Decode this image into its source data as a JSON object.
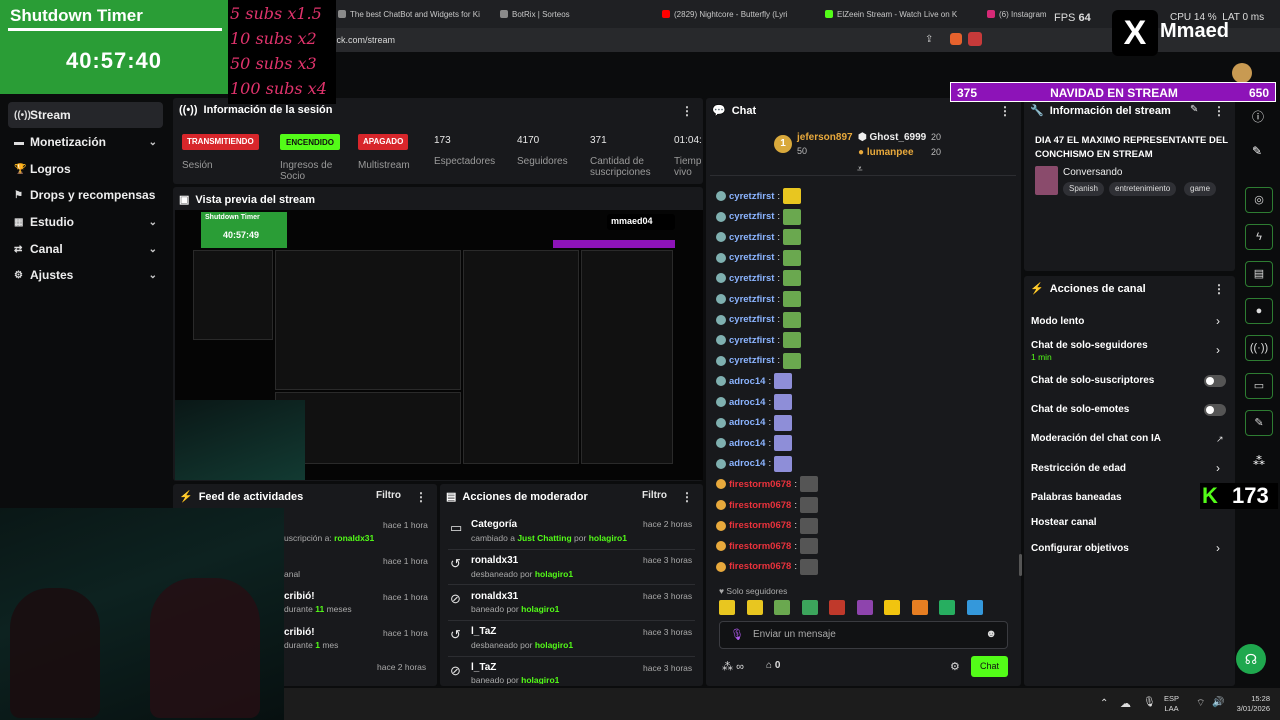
{
  "browser": {
    "tabs": [
      {
        "label": "The best ChatBot and Widgets for Ki",
        "color": "#8a8a8a"
      },
      {
        "label": "BotRix | Sorteos",
        "color": "#8a8a8a"
      },
      {
        "label": "(2829) Nightcore - Butterfly (Lyri",
        "color": "#ff0000"
      },
      {
        "label": "ElZeein Stream - Watch Live on K",
        "color": "#53fc18"
      },
      {
        "label": "(6) Instagram",
        "color": "#d62976"
      }
    ],
    "url": "kick.com/stream"
  },
  "overlay": {
    "timer_title": "Shutdown Timer",
    "timer_value": "40:57:40",
    "goals": [
      "5 subs x1.5",
      "10 subs x2",
      "50 subs x3",
      "100 subs x4"
    ],
    "fps_label": "FPS",
    "fps_value": "64",
    "cpu_label": "CPU",
    "cpu_value": "14 %",
    "lat_label": "LAT",
    "lat_value": "0 ms",
    "x_logo": "X",
    "x_name": "Mmaed",
    "navidad_left": "375",
    "navidad_title": "NAVIDAD EN STREAM",
    "navidad_right": "650",
    "kick_count": "173"
  },
  "sidebar": {
    "items": [
      {
        "label": "Stream",
        "icon": "((•))",
        "chev": false
      },
      {
        "label": "Monetización",
        "icon": "▬",
        "chev": true
      },
      {
        "label": "Logros",
        "icon": "🏆",
        "chev": false
      },
      {
        "label": "Drops y recompensas",
        "icon": "⚑",
        "chev": false
      },
      {
        "label": "Estudio",
        "icon": "▦",
        "chev": true
      },
      {
        "label": "Canal",
        "icon": "⇄",
        "chev": true
      },
      {
        "label": "Ajustes",
        "icon": "⚙",
        "chev": true
      }
    ]
  },
  "session": {
    "title": "Información de la sesión",
    "badges": [
      {
        "label": "TRANSMITIENDO",
        "caption": "Sesión",
        "color": "#d8262b"
      },
      {
        "label": "ENCENDIDO",
        "caption": "Ingresos de Socio",
        "color": "#3cb043"
      },
      {
        "label": "APAGADO",
        "caption": "Multistream",
        "color": "#d8262b"
      }
    ],
    "stats": [
      {
        "value": "173",
        "caption": "Espectadores"
      },
      {
        "value": "4170",
        "caption": "Seguidores"
      },
      {
        "value": "371",
        "caption": "Cantidad de suscripciones"
      },
      {
        "value": "01:04:",
        "caption": "Tiemp vivo"
      }
    ]
  },
  "preview": {
    "title": "Vista previa del stream",
    "timer_title": "Shutdown Timer",
    "timer_value": "40:57:49",
    "handle": "mmaed04"
  },
  "feed": {
    "title": "Feed de actividades",
    "filter": "Filtro",
    "items": [
      {
        "line1": "",
        "line2": "uscripción a:",
        "user": "ronaldx31",
        "time": "hace 1 hora"
      },
      {
        "line1": "",
        "line2": "anal",
        "user": "",
        "time": "hace 1 hora"
      },
      {
        "line1": "cribió!",
        "line2": "durante",
        "user": "11",
        "tail": "meses",
        "time": "hace 1 hora"
      },
      {
        "line1": "cribió!",
        "line2": "durante",
        "user": "1",
        "tail": "mes",
        "time": "hace 1 hora"
      },
      {
        "line1": "",
        "line2": "",
        "user": "",
        "time": "hace 2 horas"
      }
    ]
  },
  "moderator": {
    "title": "Acciones de moderador",
    "filter": "Filtro",
    "items": [
      {
        "title": "Categoría",
        "pre": "cambiado a",
        "target": "Just Chatting",
        "mid": "por",
        "by": "holagiro1",
        "time": "hace 2 horas",
        "icon": "▭"
      },
      {
        "title": "ronaldx31",
        "pre": "desbaneado por",
        "target": "",
        "mid": "",
        "by": "holagiro1",
        "time": "hace 3 horas",
        "icon": "↺"
      },
      {
        "title": "ronaldx31",
        "pre": "baneado por",
        "target": "",
        "mid": "",
        "by": "holagiro1",
        "time": "hace 3 horas",
        "icon": "⊘"
      },
      {
        "title": "l_TaZ",
        "pre": "desbaneado por",
        "target": "",
        "mid": "",
        "by": "holagiro1",
        "time": "hace 3 horas",
        "icon": "↺"
      },
      {
        "title": "l_TaZ",
        "pre": "baneado por",
        "target": "",
        "mid": "",
        "by": "holagiro1",
        "time": "hace 3 horas",
        "icon": "⊘"
      }
    ]
  },
  "chat": {
    "title": "Chat",
    "leaders": [
      {
        "name": "jeferson897",
        "value": "50"
      },
      {
        "name": "Ghost_6999",
        "value": "20"
      },
      {
        "name": "lumanpee",
        "value": "20"
      }
    ],
    "rank": "1",
    "messages": [
      {
        "user": "cyretzfirst",
        "color": "#8bb4ff",
        "emote": "#e8c620"
      },
      {
        "user": "cyretzfirst",
        "color": "#8bb4ff",
        "emote": "#6aa84f"
      },
      {
        "user": "cyretzfirst",
        "color": "#8bb4ff",
        "emote": "#6aa84f"
      },
      {
        "user": "cyretzfirst",
        "color": "#8bb4ff",
        "emote": "#6aa84f"
      },
      {
        "user": "cyretzfirst",
        "color": "#8bb4ff",
        "emote": "#6aa84f"
      },
      {
        "user": "cyretzfirst",
        "color": "#8bb4ff",
        "emote": "#6aa84f"
      },
      {
        "user": "cyretzfirst",
        "color": "#8bb4ff",
        "emote": "#6aa84f"
      },
      {
        "user": "cyretzfirst",
        "color": "#8bb4ff",
        "emote": "#6aa84f"
      },
      {
        "user": "cyretzfirst",
        "color": "#8bb4ff",
        "emote": "#6aa84f"
      },
      {
        "user": "adroc14",
        "color": "#8bb4ff",
        "emote": "#8e8ed8"
      },
      {
        "user": "adroc14",
        "color": "#8bb4ff",
        "emote": "#8e8ed8"
      },
      {
        "user": "adroc14",
        "color": "#8bb4ff",
        "emote": "#8e8ed8"
      },
      {
        "user": "adroc14",
        "color": "#8bb4ff",
        "emote": "#8e8ed8"
      },
      {
        "user": "adroc14",
        "color": "#8bb4ff",
        "emote": "#8e8ed8"
      },
      {
        "user": "firestorm0678",
        "color": "#e8323c",
        "emote": "#555555"
      },
      {
        "user": "firestorm0678",
        "color": "#e8323c",
        "emote": "#555555"
      },
      {
        "user": "firestorm0678",
        "color": "#e8323c",
        "emote": "#555555"
      },
      {
        "user": "firestorm0678",
        "color": "#e8323c",
        "emote": "#555555"
      },
      {
        "user": "firestorm0678",
        "color": "#e8323c",
        "emote": "#555555"
      }
    ],
    "followers_only": "Solo seguidores",
    "input_placeholder": "Enviar un mensaje",
    "infinite": "∞",
    "gift_count": "0",
    "send_label": "Chat",
    "emote_bar": [
      "#e8c620",
      "#e8c620",
      "#6aa84f",
      "#3ca55c",
      "#c0392b",
      "#8e44ad",
      "#f1c40f",
      "#e67e22",
      "#27ae60",
      "#3498db"
    ]
  },
  "stream_info": {
    "title": "Información del stream",
    "stream_title": "DIA 47 EL MAXIMO REPRESENTANTE DEL CONCHISMO EN STREAM",
    "category": "Conversando",
    "tags": [
      "Spanish",
      "entretenimiento",
      "game"
    ]
  },
  "channel_actions": {
    "title": "Acciones de canal",
    "items": [
      {
        "label": "Modo lento",
        "sub": "",
        "control": "chevron"
      },
      {
        "label": "Chat de solo-seguidores",
        "sub": "1 min",
        "control": "chevron"
      },
      {
        "label": "Chat de solo-suscriptores",
        "sub": "",
        "control": "toggle"
      },
      {
        "label": "Chat de solo-emotes",
        "sub": "",
        "control": "toggle"
      },
      {
        "label": "Moderación del chat con IA",
        "sub": "",
        "control": "external"
      },
      {
        "label": "Restricción de edad",
        "sub": "",
        "control": "chevron"
      },
      {
        "label": "Palabras baneadas",
        "sub": "",
        "control": "none"
      },
      {
        "label": "Hostear canal",
        "sub": "",
        "control": "none"
      },
      {
        "label": "Configurar objetivos",
        "sub": "",
        "control": "chevron"
      }
    ]
  },
  "taskbar": {
    "lang1": "ESP",
    "lang2": "LAA",
    "time": "15:28",
    "date": "3/01/2026"
  },
  "colors": {
    "kick_green": "#53fc18",
    "panel": "#18191c",
    "timer_bg": "#2a9d36",
    "navidad_bg": "#8d13b8"
  }
}
